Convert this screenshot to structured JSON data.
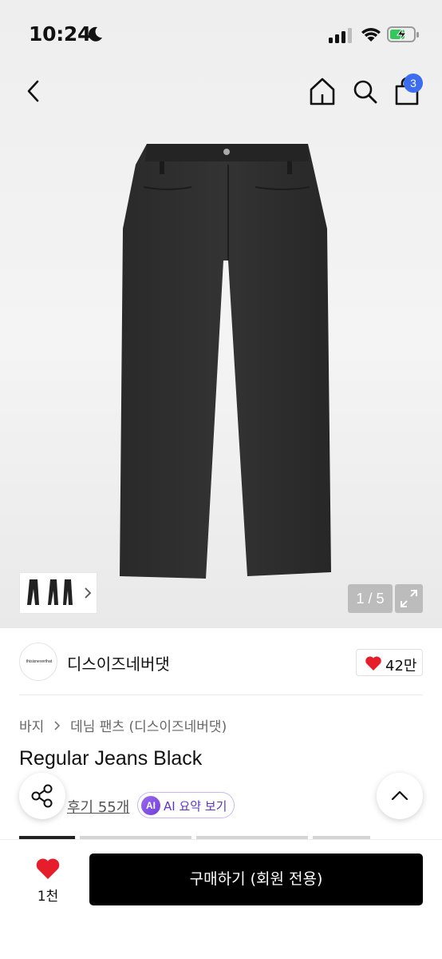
{
  "status_bar": {
    "time": "10:24",
    "icons": [
      "moon-icon",
      "signal-icon",
      "wifi-icon",
      "battery-charging-icon"
    ]
  },
  "nav": {
    "icons": [
      "back-icon",
      "home-icon",
      "search-icon",
      "shopping-bag-icon"
    ],
    "cart_count": "3"
  },
  "gallery": {
    "counter": "1 / 5",
    "icons": [
      "chevron-right-icon",
      "expand-icon"
    ]
  },
  "brand": {
    "logo_text": "thisisneverthat",
    "name": "디스이즈네버댓",
    "like_count": "42만",
    "like_color": "#e61e2b"
  },
  "breadcrumb": [
    "바지",
    "데님 팬츠 (디스이즈네버댓)"
  ],
  "product": {
    "title": "Regular Jeans Black",
    "review_link": "후기 55개",
    "ai_badge": "AI",
    "ai_label": "AI 요약 보기"
  },
  "bottom_bar": {
    "wish_count": "1천",
    "buy_label": "구매하기 (회원 전용)",
    "buy_color": "#000000"
  }
}
